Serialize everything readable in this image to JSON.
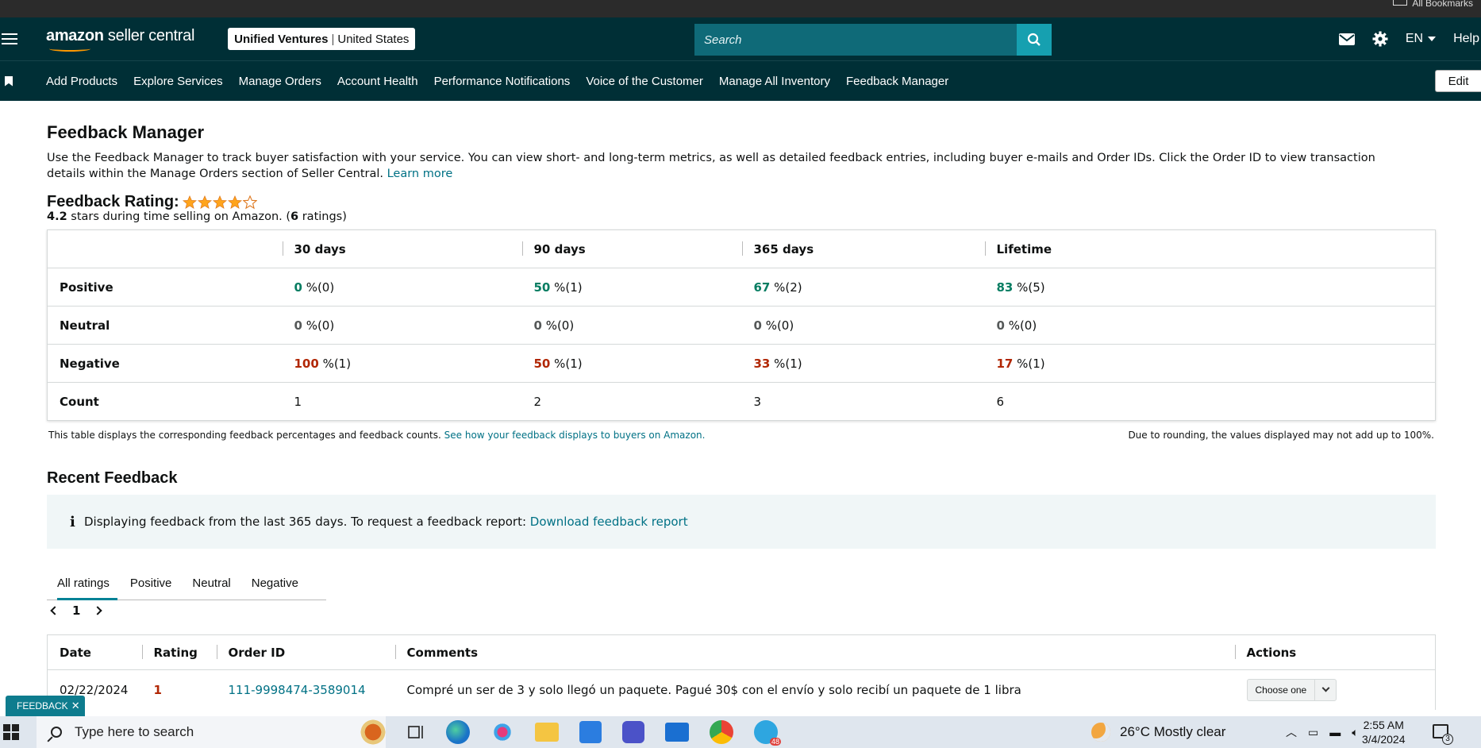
{
  "browser": {
    "bookmarks_label": "All Bookmarks"
  },
  "header": {
    "logo_brand": "amazon",
    "logo_product": " seller central",
    "account_name": "Unified Ventures",
    "account_region": "United States",
    "search_placeholder": "Search",
    "language": "EN",
    "help": "Help"
  },
  "nav": {
    "items": [
      "Add Products",
      "Explore Services",
      "Manage Orders",
      "Account Health",
      "Performance Notifications",
      "Voice of the Customer",
      "Manage All Inventory",
      "Feedback Manager"
    ],
    "edit": "Edit"
  },
  "page": {
    "title": "Feedback Manager",
    "intro": "Use the Feedback Manager to track buyer satisfaction with your service. You can view short- and long-term metrics, as well as detailed feedback entries, including buyer e-mails and Order IDs. Click the Order ID to view transaction details within the Manage Orders section of Seller Central. ",
    "learn_more": "Learn more"
  },
  "rating": {
    "label": "Feedback Rating:",
    "stars": 4,
    "max_stars": 5,
    "score": "4.2",
    "sub_mid": " stars during time selling on Amazon. (",
    "count": "6",
    "sub_end": " ratings)"
  },
  "metrics": {
    "columns": [
      "30 days",
      "90 days",
      "365 days",
      "Lifetime"
    ],
    "rows": {
      "positive": {
        "label": "Positive",
        "values": [
          [
            "0",
            " %(0)"
          ],
          [
            "50",
            " %(1)"
          ],
          [
            "67",
            " %(2)"
          ],
          [
            "83",
            " %(5)"
          ]
        ]
      },
      "neutral": {
        "label": "Neutral",
        "values": [
          [
            "0",
            " %(0)"
          ],
          [
            "0",
            " %(0)"
          ],
          [
            "0",
            " %(0)"
          ],
          [
            "0",
            " %(0)"
          ]
        ]
      },
      "negative": {
        "label": "Negative",
        "values": [
          [
            "100",
            " %(1)"
          ],
          [
            "50",
            " %(1)"
          ],
          [
            "33",
            " %(1)"
          ],
          [
            "17",
            " %(1)"
          ]
        ]
      },
      "count": {
        "label": "Count",
        "values": [
          "1",
          "2",
          "3",
          "6"
        ]
      }
    },
    "note_left": "This table displays the corresponding feedback percentages and feedback counts. ",
    "note_link": "See how your feedback displays to buyers on Amazon.",
    "note_right": "Due to rounding, the values displayed may not add up to 100%."
  },
  "recent": {
    "title": "Recent Feedback",
    "info": "Displaying feedback from the last 365 days. To request a feedback report: ",
    "download": "Download feedback report",
    "tabs": [
      "All ratings",
      "Positive",
      "Neutral",
      "Negative"
    ],
    "page": "1",
    "columns": [
      "Date",
      "Rating",
      "Order ID",
      "Comments",
      "Actions"
    ],
    "rows": [
      {
        "date": "02/22/2024",
        "rating": "1",
        "order_id": "111-9998474-3589014",
        "comment": "Compré un ser de 3 y solo llegó un paquete. Pagué 30$ con el envío y solo recibí un paquete de 1 libra",
        "action": "Choose one"
      }
    ]
  },
  "feedback_tab": "FEEDBACK",
  "taskbar": {
    "search_placeholder": "Type here to search",
    "weather": "26°C  Mostly clear",
    "time": "2:55 AM",
    "date": "3/4/2024",
    "telegram_badge": "48",
    "notif_badge": "3"
  },
  "colors": {
    "header_bg": "#002f36",
    "search_btn": "#16a0b0",
    "link": "#007185",
    "positive": "#067d62",
    "negative": "#b12704",
    "star": "#ffa41c"
  }
}
